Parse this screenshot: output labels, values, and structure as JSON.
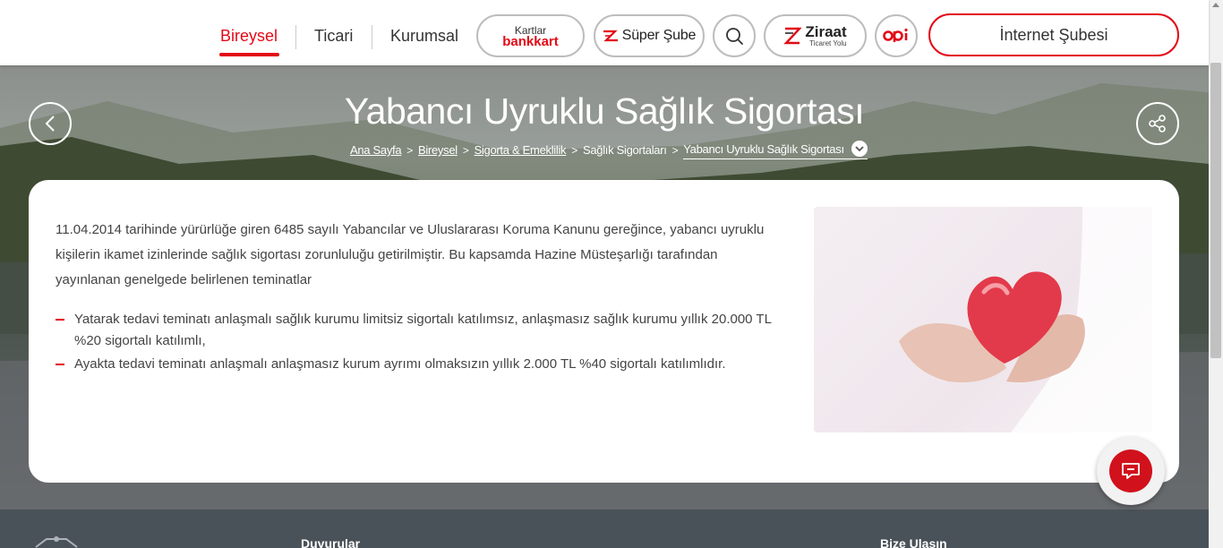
{
  "header": {
    "nav": [
      {
        "label": "Bireysel",
        "active": true
      },
      {
        "label": "Ticari",
        "active": false
      },
      {
        "label": "Kurumsal",
        "active": false
      }
    ],
    "kartlar": {
      "top": "Kartlar",
      "brand": "bankkart"
    },
    "super_sube": {
      "icon": "z-logo",
      "label": "Süper Şube"
    },
    "search": {
      "icon": "search-icon"
    },
    "ziraat": {
      "main": "Ziraat",
      "sub": "Ticaret Yolu"
    },
    "opi": {
      "label": "opi"
    },
    "internet_subesi": "İnternet Şubesi"
  },
  "hero": {
    "title": "Yabancı Uyruklu Sağlık Sigortası",
    "breadcrumb": [
      {
        "label": "Ana Sayfa"
      },
      {
        "label": "Bireysel"
      },
      {
        "label": "Sigorta & Emeklilik"
      },
      {
        "label": "Sağlık Sigortaları"
      },
      {
        "label": "Yabancı Uyruklu Sağlık Sigortası"
      }
    ]
  },
  "content": {
    "intro": "11.04.2014 tarihinde yürürlüğe giren 6485 sayılı Yabancılar ve Uluslararası Koruma Kanunu gereğince, yabancı uyruklu kişilerin ikamet izinlerinde sağlık sigortası zorunluluğu getirilmiştir. Bu kapsamda Hazine Müsteşarlığı tarafından yayınlanan genelgede belirlenen teminatlar",
    "bullets": [
      "Yatarak tedavi teminatı anlaşmalı sağlık kurumu limitsiz sigortalı katılımsız, anlaşmasız sağlık kurumu yıllık 20.000 TL %20 sigortalı katılımlı,",
      "Ayakta tedavi teminatı anlaşmalı anlaşmasız kurum ayrımı olmaksızın yıllık 2.000 TL %40 sigortalı katılımlıdır."
    ]
  },
  "footer": {
    "duyurular": "Duyurular",
    "bize_ulasin": "Bize Ulaşın"
  },
  "colors": {
    "brand": "#e30a17",
    "footer": "#4a5259"
  }
}
